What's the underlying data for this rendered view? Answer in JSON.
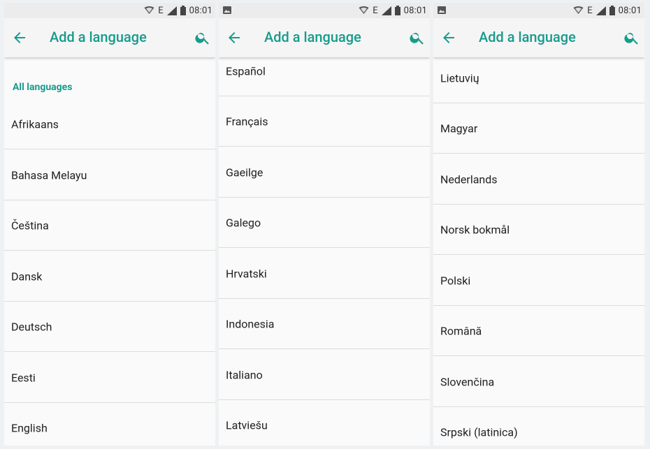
{
  "status_bar": {
    "time": "08:01"
  },
  "screens": [
    {
      "title": "Add a language",
      "section_header": "All languages",
      "languages": [
        "Afrikaans",
        "Bahasa Melayu",
        "Čeština",
        "Dansk",
        "Deutsch",
        "Eesti",
        "English"
      ]
    },
    {
      "title": "Add a language",
      "languages": [
        "Español",
        "Français",
        "Gaeilge",
        "Galego",
        "Hrvatski",
        "Indonesia",
        "Italiano",
        "Latviešu"
      ]
    },
    {
      "title": "Add a language",
      "languages": [
        "Lietuvių",
        "Magyar",
        "Nederlands",
        "Norsk bokmål",
        "Polski",
        "Română",
        "Slovenčina",
        "Srpski (latinica)"
      ]
    }
  ],
  "colors": {
    "accent": "#169b8c",
    "text": "#212121",
    "divider": "#dcdcdc",
    "statusbar": "#ececec",
    "background": "#fafafa"
  },
  "icons": {
    "back": "arrow-left-icon",
    "search": "search-icon",
    "signal": "signal-icon",
    "battery": "battery-icon",
    "wifi": "wifi-icon",
    "notification": "image-notification-icon"
  }
}
